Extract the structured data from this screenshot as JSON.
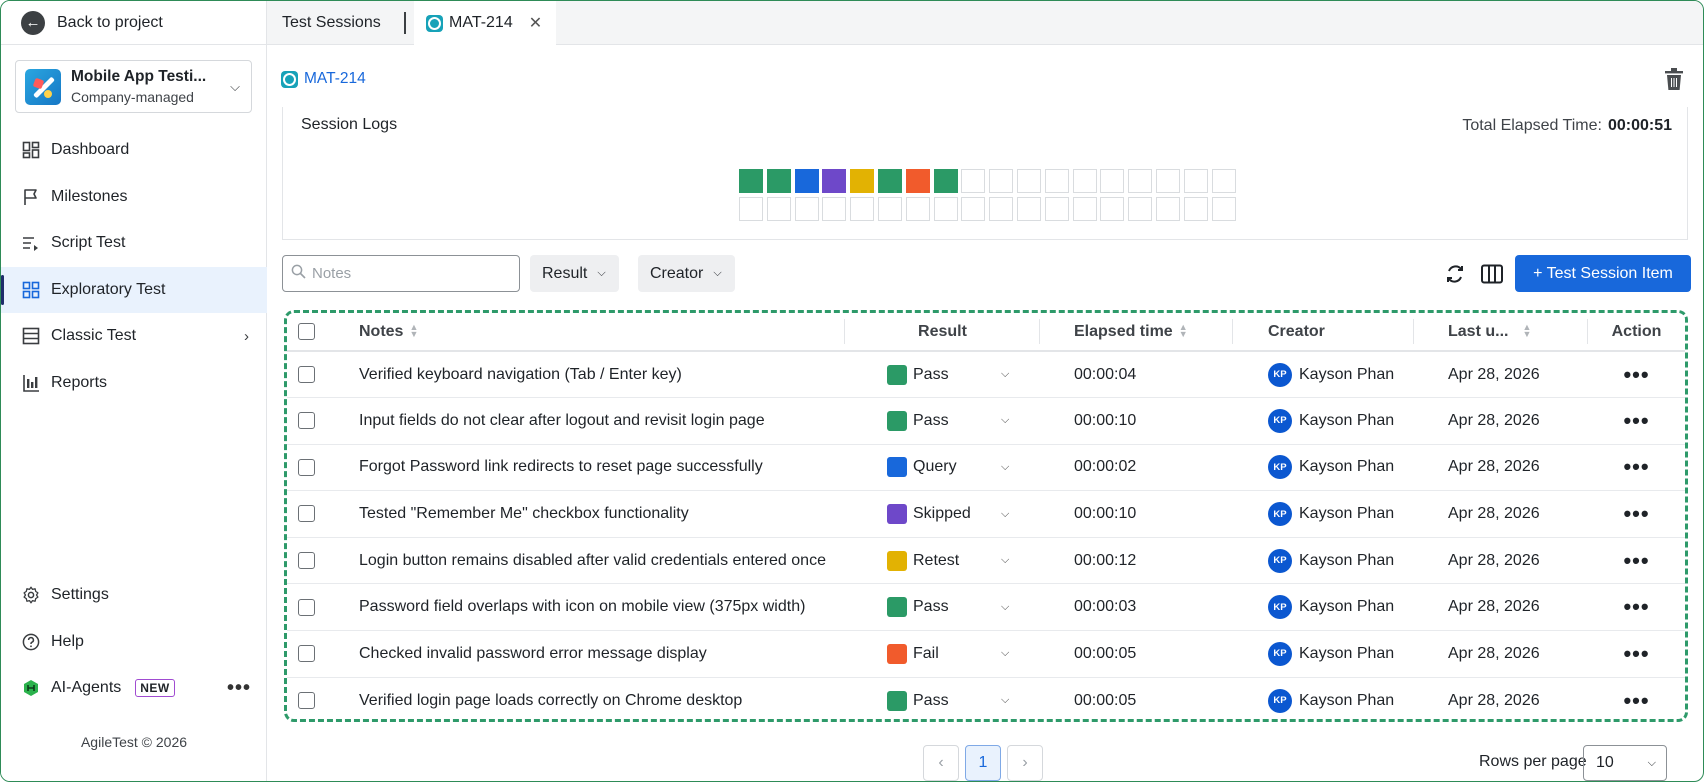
{
  "sidebar": {
    "back_label": "Back to project",
    "project": {
      "name": "Mobile App Testi...",
      "type": "Company-managed"
    },
    "items": [
      {
        "label": "Dashboard",
        "icon": "dashboard-icon"
      },
      {
        "label": "Milestones",
        "icon": "flag-icon"
      },
      {
        "label": "Script Test",
        "icon": "script-list-icon"
      },
      {
        "label": "Exploratory Test",
        "icon": "grid-icon",
        "active": true
      },
      {
        "label": "Classic Test",
        "icon": "table-icon"
      },
      {
        "label": "Reports",
        "icon": "bar-chart-icon"
      }
    ],
    "bottom": {
      "settings": "Settings",
      "help": "Help",
      "ai_agents": "AI-Agents",
      "new_badge": "NEW"
    },
    "copyright": "AgileTest © 2026"
  },
  "tabs": [
    {
      "label": "Test Sessions"
    },
    {
      "label": "MAT-214",
      "active": true
    }
  ],
  "header": {
    "session_key": "MAT-214"
  },
  "session_logs": {
    "title": "Session Logs",
    "elapsed_label": "Total Elapsed Time:",
    "elapsed_value": "00:00:51",
    "filled_colors": [
      "#2b9a66",
      "#2b9a66",
      "#1868db",
      "#6e48c9",
      "#e2b203",
      "#2b9a66",
      "#f15b2c",
      "#2b9a66"
    ],
    "total_cells": 36
  },
  "toolbar": {
    "notes_placeholder": "Notes",
    "result_label": "Result",
    "creator_label": "Creator",
    "add_label": "+ Test Session Item"
  },
  "table": {
    "headers": {
      "notes": "Notes",
      "result": "Result",
      "elapsed": "Elapsed time",
      "creator": "Creator",
      "last_updated": "Last u...",
      "action": "Action"
    },
    "rows": [
      {
        "note": "Verified keyboard navigation (Tab / Enter key)",
        "result": "Pass",
        "color": "#2b9a66",
        "elapsed": "00:00:04",
        "initials": "KP",
        "creator": "Kayson Phan",
        "date": "Apr 28, 2026"
      },
      {
        "note": "Input fields do not clear after logout and revisit login page",
        "result": "Pass",
        "color": "#2b9a66",
        "elapsed": "00:00:10",
        "initials": "KP",
        "creator": "Kayson Phan",
        "date": "Apr 28, 2026"
      },
      {
        "note": "Forgot Password link redirects to reset page successfully",
        "result": "Query",
        "color": "#1868db",
        "elapsed": "00:00:02",
        "initials": "KP",
        "creator": "Kayson Phan",
        "date": "Apr 28, 2026"
      },
      {
        "note": "Tested \"Remember Me\" checkbox functionality",
        "result": "Skipped",
        "color": "#6e48c9",
        "elapsed": "00:00:10",
        "initials": "KP",
        "creator": "Kayson Phan",
        "date": "Apr 28, 2026"
      },
      {
        "note": "Login button remains disabled after valid credentials entered once",
        "result": "Retest",
        "color": "#e2b203",
        "elapsed": "00:00:12",
        "initials": "KP",
        "creator": "Kayson Phan",
        "date": "Apr 28, 2026"
      },
      {
        "note": "Password field overlaps with icon on mobile view (375px width)",
        "result": "Pass",
        "color": "#2b9a66",
        "elapsed": "00:00:03",
        "initials": "KP",
        "creator": "Kayson Phan",
        "date": "Apr 28, 2026"
      },
      {
        "note": "Checked invalid password error message display",
        "result": "Fail",
        "color": "#f15b2c",
        "elapsed": "00:00:05",
        "initials": "KP",
        "creator": "Kayson Phan",
        "date": "Apr 28, 2026"
      },
      {
        "note": "Verified login page loads correctly on Chrome desktop",
        "result": "Pass",
        "color": "#2b9a66",
        "elapsed": "00:00:05",
        "initials": "KP",
        "creator": "Kayson Phan",
        "date": "Apr 28, 2026"
      }
    ]
  },
  "pagination": {
    "prev": "‹",
    "current": "1",
    "next": "›",
    "rows_per_page_label": "Rows per page",
    "rows_per_page": "10"
  }
}
